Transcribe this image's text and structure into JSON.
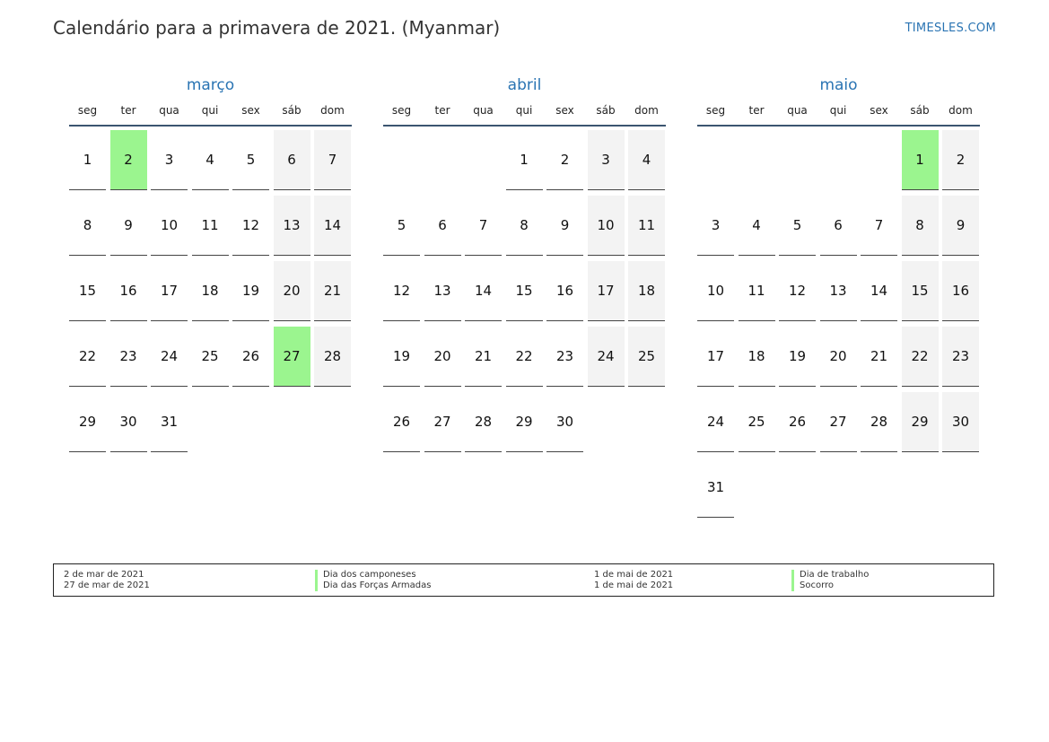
{
  "header": {
    "title": "Calendário para a primavera de 2021. (Myanmar)",
    "site": "TIMESLES.COM"
  },
  "colors": {
    "accent": "#2a74b3",
    "holiday": "#9bf58f",
    "weekend": "#f3f3f3"
  },
  "weekdays": [
    "seg",
    "ter",
    "qua",
    "qui",
    "sex",
    "sáb",
    "dom"
  ],
  "months": [
    {
      "name": "março",
      "offset": 0,
      "days": 31,
      "holidays": [
        2,
        27
      ]
    },
    {
      "name": "abril",
      "offset": 3,
      "days": 30,
      "holidays": []
    },
    {
      "name": "maio",
      "offset": 5,
      "days": 31,
      "holidays": [
        1
      ]
    }
  ],
  "legend": [
    {
      "date": "2 de mar de 2021",
      "name": "Dia dos camponeses"
    },
    {
      "date": "27 de mar de 2021",
      "name": "Dia das Forças Armadas"
    },
    {
      "date": "1 de mai de 2021",
      "name": "Dia de trabalho"
    },
    {
      "date": "1 de mai de 2021",
      "name": "Socorro"
    }
  ]
}
